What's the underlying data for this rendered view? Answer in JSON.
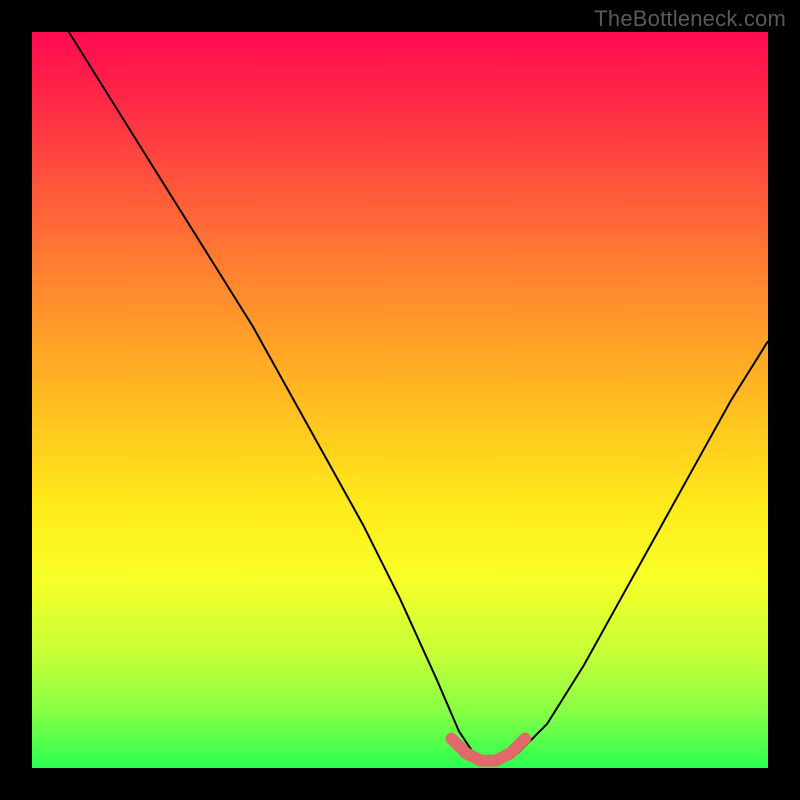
{
  "watermark": "TheBottleneck.com",
  "chart_data": {
    "type": "line",
    "title": "",
    "xlabel": "",
    "ylabel": "",
    "xlim": [
      0,
      100
    ],
    "ylim": [
      0,
      100
    ],
    "grid": false,
    "legend": false,
    "series": [
      {
        "name": "curve",
        "color": "#000000",
        "x": [
          5,
          10,
          15,
          20,
          25,
          30,
          35,
          40,
          45,
          50,
          55,
          58,
          60,
          62,
          64,
          66,
          70,
          75,
          80,
          85,
          90,
          95,
          100
        ],
        "y": [
          100,
          92,
          84,
          76,
          68,
          60,
          51,
          42,
          33,
          23,
          12,
          5,
          2,
          1,
          1,
          2,
          6,
          14,
          23,
          32,
          41,
          50,
          58
        ]
      }
    ],
    "annotations": [
      {
        "name": "valley-highlight",
        "color": "#e06a6a",
        "x": [
          57,
          59,
          61,
          63,
          65,
          67
        ],
        "y": [
          4,
          2,
          1,
          1,
          2,
          4
        ]
      }
    ],
    "background": {
      "type": "vertical-gradient",
      "stops": [
        {
          "pos": 0,
          "color": "#ff0a50"
        },
        {
          "pos": 22,
          "color": "#ff5a3a"
        },
        {
          "pos": 48,
          "color": "#ffb522"
        },
        {
          "pos": 74,
          "color": "#f8ff28"
        },
        {
          "pos": 100,
          "color": "#2bff52"
        }
      ]
    }
  }
}
